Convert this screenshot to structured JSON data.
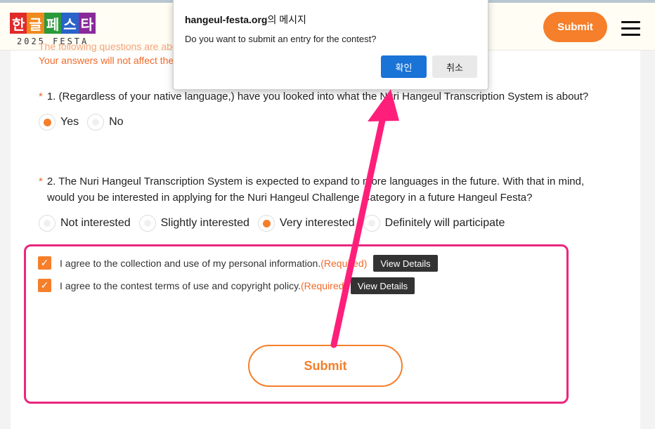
{
  "header": {
    "logo": {
      "tiles": [
        {
          "char": "한",
          "color": "#e02a2a"
        },
        {
          "char": "글",
          "color": "#f08a1e"
        },
        {
          "char": "페",
          "color": "#2a9a3a"
        },
        {
          "char": "스",
          "color": "#2a63c9"
        },
        {
          "char": "타",
          "color": "#8a2a9a"
        }
      ],
      "sub": "2025 FESTA"
    },
    "submit_label": "Submit"
  },
  "notice": {
    "line1_fragment": "The following questions are about … … … … … … … … … … … … … … … ings Edit.",
    "line2": "Your answers will not affect the"
  },
  "questions": [
    {
      "star": "*",
      "text": "1. (Regardless of your native language,) have you looked into what the Nuri Hangeul Transcription System is about?",
      "options": [
        {
          "label": "Yes",
          "selected": true
        },
        {
          "label": "No",
          "selected": false
        }
      ]
    },
    {
      "star": "*",
      "line1": "2. The Nuri Hangeul Transcription System is expected to expand to more languages in the future. With that in mind,",
      "line2": "would you be interested in applying for the Nuri Hangeul Challenge Category in a future Hangeul Festa?",
      "options": [
        {
          "label": "Not interested",
          "selected": false
        },
        {
          "label": "Slightly interested",
          "selected": false
        },
        {
          "label": "Very interested",
          "selected": true
        },
        {
          "label": "Definitely will participate",
          "selected": false
        }
      ]
    }
  ],
  "consents": [
    {
      "text": "I agree to the collection and use of my personal information.",
      "required": "(Required)",
      "details_label": "View Details",
      "checked": true
    },
    {
      "text": "I agree to the contest terms of use and copyright policy.",
      "required": "(Required)",
      "details_label": "View Details",
      "checked": true
    }
  ],
  "submit_label": "Submit",
  "dialog": {
    "title_site": "hangeul-festa.org",
    "title_suffix": "의 메시지",
    "message": "Do you want to submit an entry for the contest?",
    "ok_label": "확인",
    "cancel_label": "취소"
  },
  "colors": {
    "accent": "#f57f2a",
    "highlight": "#ea2680",
    "dialog_primary": "#1a73d6"
  }
}
